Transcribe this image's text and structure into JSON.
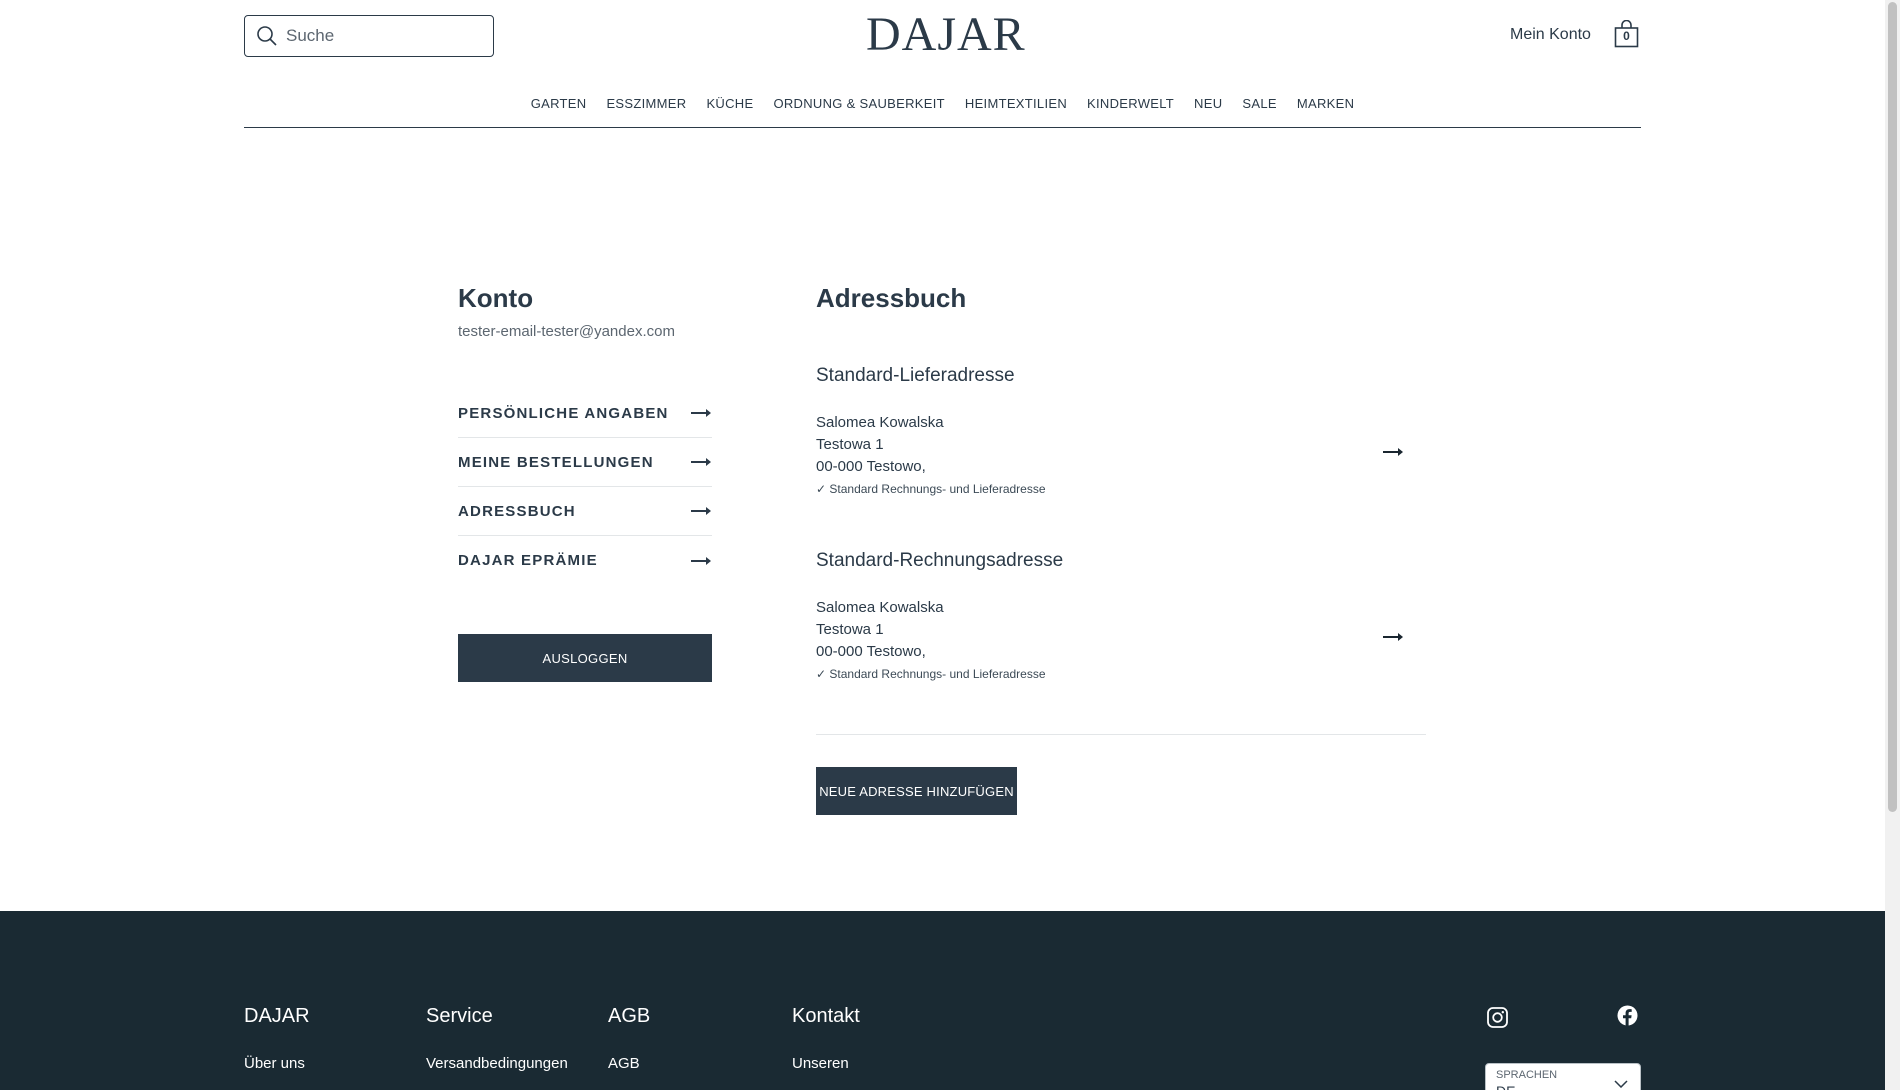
{
  "header": {
    "search_placeholder": "Suche",
    "logo": "DAJAR",
    "account_link": "Mein Konto",
    "cart_count": "0"
  },
  "nav": [
    "GARTEN",
    "ESSZIMMER",
    "KÜCHE",
    "ORDNUNG & SAUBERKEIT",
    "HEIMTEXTILIEN",
    "KINDERWELT",
    "NEU",
    "SALE",
    "MARKEN"
  ],
  "account": {
    "title": "Konto",
    "email": "tester-email-tester@yandex.com",
    "menu": [
      "PERSÖNLICHE ANGABEN",
      "MEINE BESTELLUNGEN",
      "ADRESSBUCH",
      "DAJAR EPRÄMIE"
    ],
    "logout": "AUSLOGGEN"
  },
  "addressbook": {
    "title": "Adressbuch",
    "addresses": [
      {
        "heading": "Standard-Lieferadresse",
        "name": "Salomea Kowalska",
        "street": "Testowa 1",
        "city": "00-000 Testowo,",
        "note": "✓ Standard Rechnungs- und Lieferadresse"
      },
      {
        "heading": "Standard-Rechnungsadresse",
        "name": "Salomea Kowalska",
        "street": "Testowa 1",
        "city": "00-000 Testowo,",
        "note": "✓ Standard Rechnungs- und Lieferadresse"
      }
    ],
    "add_button": "NEUE ADRESSE HINZUFÜGEN"
  },
  "footer": {
    "columns": [
      {
        "heading": "DAJAR",
        "link": "Über uns"
      },
      {
        "heading": "Service",
        "link": "Versandbedingungen"
      },
      {
        "heading": "AGB",
        "link": "AGB"
      },
      {
        "heading": "Kontakt",
        "link": "Unseren"
      }
    ],
    "language_label": "SPRACHEN",
    "language_value": "DE"
  },
  "colors": {
    "primary": "#2b3a48",
    "footer_bg": "#1a2a33",
    "divider": "#e3e6e8"
  },
  "icons": [
    "search-icon",
    "bag-icon",
    "arrow-right-icon",
    "instagram-icon",
    "facebook-icon",
    "chevron-down-icon"
  ]
}
